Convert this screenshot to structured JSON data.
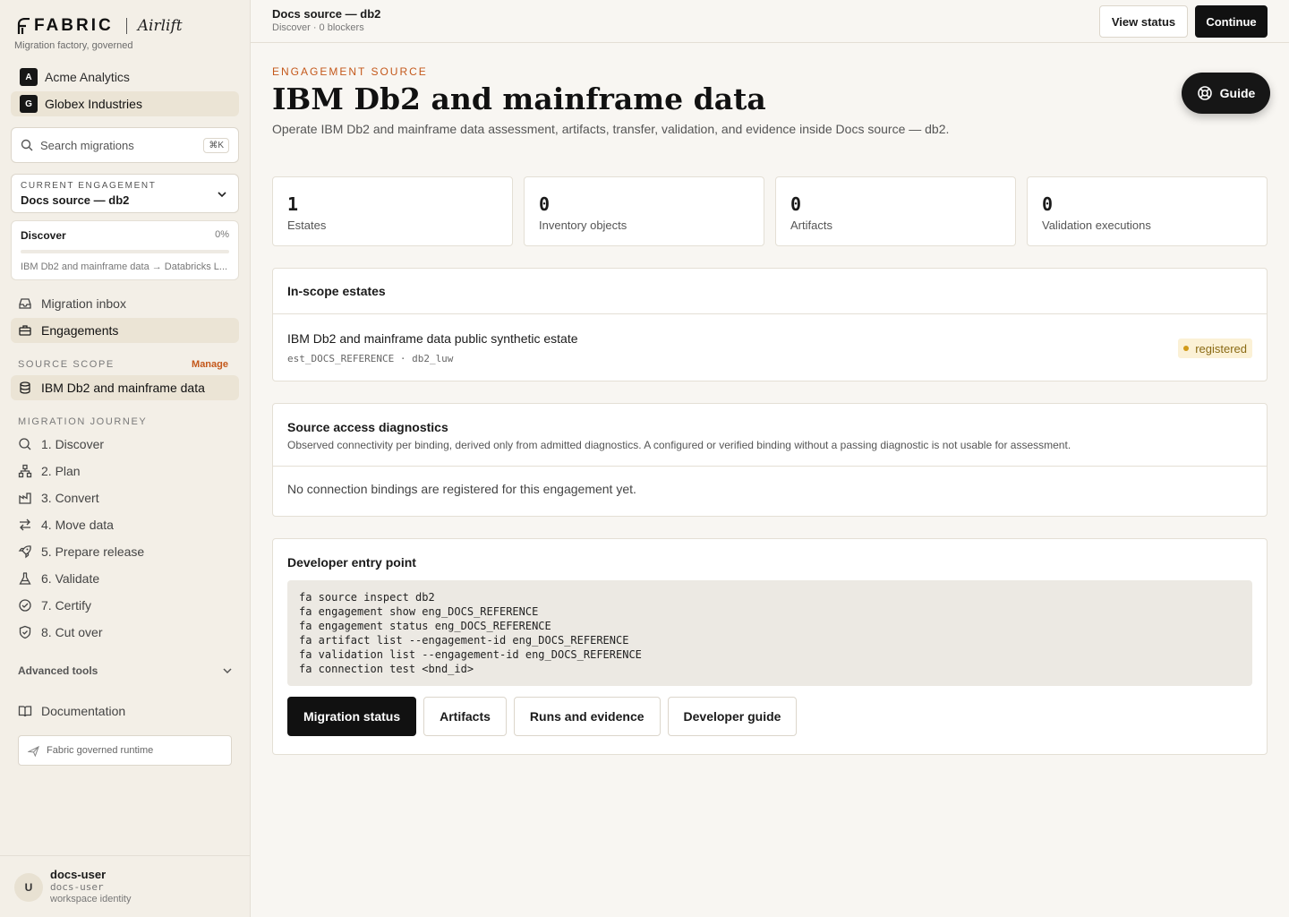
{
  "brand": {
    "wordmark": "FABRIC",
    "product": "Airlift",
    "tagline": "Migration factory, governed"
  },
  "orgs": [
    {
      "initial": "A",
      "name": "Acme Analytics",
      "active": false
    },
    {
      "initial": "G",
      "name": "Globex Industries",
      "active": true
    }
  ],
  "search": {
    "placeholder": "Search migrations",
    "shortcut": "⌘K"
  },
  "engagement": {
    "label": "CURRENT ENGAGEMENT",
    "value": "Docs source — db2"
  },
  "phase": {
    "name": "Discover",
    "percent_label": "0%",
    "progress": 0,
    "route": "IBM Db2 and mainframe data → Databricks L..."
  },
  "nav_primary": [
    {
      "label": "Migration inbox",
      "icon": "inbox-icon",
      "active": false
    },
    {
      "label": "Engagements",
      "icon": "briefcase-icon",
      "active": true
    }
  ],
  "source_scope": {
    "label": "SOURCE SCOPE",
    "manage": "Manage",
    "item": "IBM Db2 and mainframe data",
    "icon": "database-icon"
  },
  "journey": {
    "label": "MIGRATION JOURNEY",
    "steps": [
      {
        "label": "1. Discover",
        "icon": "search-icon"
      },
      {
        "label": "2. Plan",
        "icon": "hierarchy-icon"
      },
      {
        "label": "3. Convert",
        "icon": "factory-icon"
      },
      {
        "label": "4. Move data",
        "icon": "arrows-exchange-icon"
      },
      {
        "label": "5. Prepare release",
        "icon": "rocket-icon"
      },
      {
        "label": "6. Validate",
        "icon": "flask-icon"
      },
      {
        "label": "7. Certify",
        "icon": "check-circle-icon"
      },
      {
        "label": "8. Cut over",
        "icon": "shield-check-icon"
      }
    ]
  },
  "advanced_tools": "Advanced tools",
  "documentation": "Documentation",
  "runtime": "Fabric governed runtime",
  "user": {
    "initial": "U",
    "name": "docs-user",
    "handle": "docs-user",
    "role": "workspace identity"
  },
  "topbar": {
    "title": "Docs source — db2",
    "subtitle": "Discover · 0 blockers",
    "view_status": "View status",
    "continue": "Continue"
  },
  "page": {
    "eyebrow": "ENGAGEMENT SOURCE",
    "title": "IBM Db2 and mainframe data",
    "description": "Operate IBM Db2 and mainframe data assessment, artifacts, transfer, validation, and evidence inside Docs source — db2.",
    "guide": "Guide"
  },
  "stats": [
    {
      "value": "1",
      "label": "Estates"
    },
    {
      "value": "0",
      "label": "Inventory objects"
    },
    {
      "value": "0",
      "label": "Artifacts"
    },
    {
      "value": "0",
      "label": "Validation executions"
    }
  ],
  "estates": {
    "title": "In-scope estates",
    "item": {
      "name": "IBM Db2 and mainframe data public synthetic estate",
      "meta": "est_DOCS_REFERENCE · db2_luw",
      "status": "registered"
    }
  },
  "diagnostics": {
    "title": "Source access diagnostics",
    "subtitle": "Observed connectivity per binding, derived only from admitted diagnostics. A configured or verified binding without a passing diagnostic is not usable for assessment.",
    "empty": "No connection bindings are registered for this engagement yet."
  },
  "developer": {
    "title": "Developer entry point",
    "code": "fa source inspect db2\nfa engagement show eng_DOCS_REFERENCE\nfa engagement status eng_DOCS_REFERENCE\nfa artifact list --engagement-id eng_DOCS_REFERENCE\nfa validation list --engagement-id eng_DOCS_REFERENCE\nfa connection test <bnd_id>",
    "buttons": {
      "migration_status": "Migration status",
      "artifacts": "Artifacts",
      "runs": "Runs and evidence",
      "guide": "Developer guide"
    }
  }
}
